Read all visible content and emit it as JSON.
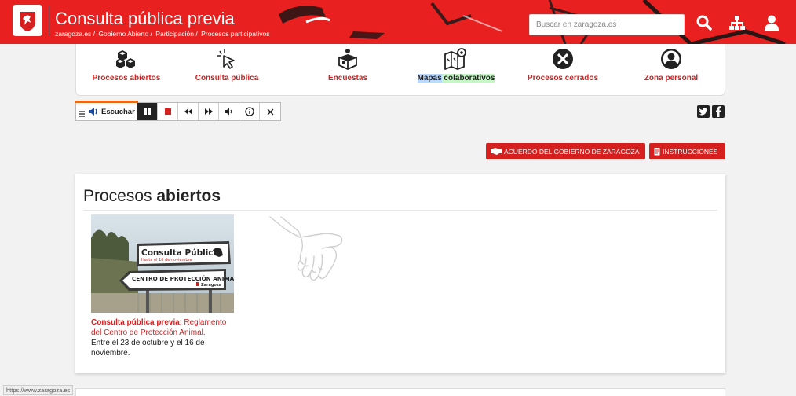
{
  "header": {
    "title": "Consulta pública previa",
    "breadcrumb": [
      "zaragoza.es /",
      "Gobierno Abierto /",
      "Participación /",
      "Procesos participativos"
    ],
    "search_placeholder": "Buscar en zaragoza.es",
    "brand_color": "#e8201f",
    "icons": [
      "search-icon",
      "sitemap-icon",
      "user-icon"
    ]
  },
  "nav": {
    "items": [
      {
        "label": "Procesos abiertos",
        "icon": "cubes-icon"
      },
      {
        "label": "Consulta pública",
        "icon": "pointer-icon"
      },
      {
        "label": "Encuestas",
        "icon": "ballot-box-icon"
      },
      {
        "label_a": "Mapas",
        "label_b": " colaborativos",
        "icon": "map-icon"
      },
      {
        "label": "Procesos cerrados",
        "icon": "close-circle-icon"
      },
      {
        "label": "Zona personal",
        "icon": "person-circle-icon"
      }
    ]
  },
  "reader": {
    "listen_label": "Escuchar",
    "accent": "#e56a1c"
  },
  "share": {
    "twitter": "twitter-icon",
    "facebook": "facebook-icon"
  },
  "actions": {
    "agreement_label": "ACUERDO DEL GOBIERNO DE ZARAGOZA",
    "instructions_label": "INSTRUCCIONES"
  },
  "main": {
    "title_plain": "Procesos ",
    "title_bold": "abiertos",
    "item": {
      "sign_top": "Consulta Pública",
      "sign_top_sub": "Hasta el 16 de noviembre",
      "sign_bottom": "CENTRO DE PROTECCIÓN ANIMAL",
      "sign_city": "Zaragoza",
      "caption_prefix": "Consulta pública previa",
      "caption_link": ": Reglamento del Centro de Protección Animal.",
      "caption_dates": "Entre el 23 de octubre y el 16 de noviembre."
    }
  },
  "status_url": "https://www.zaragoza.es"
}
